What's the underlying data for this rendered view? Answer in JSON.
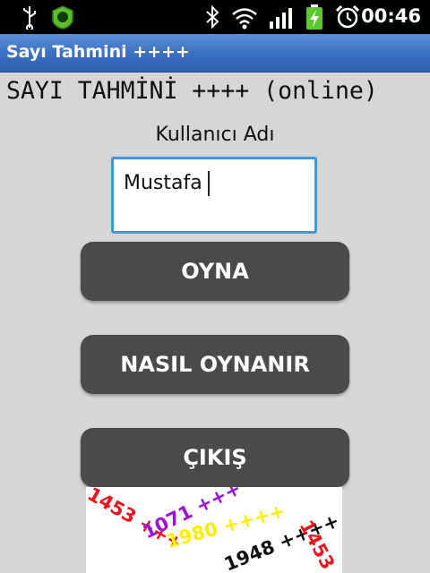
{
  "status_bar": {
    "time": "00:46",
    "icons": [
      "usb-icon",
      "app-notification-icon",
      "bluetooth-icon",
      "wifi-icon",
      "signal-icon",
      "battery-charging-icon",
      "alarm-icon"
    ]
  },
  "title_bar": {
    "title": "Sayı Tahmini ++++"
  },
  "main": {
    "headline": "SAYI TAHMİNİ ++++ (online)",
    "username_label": "Kullanıcı Adı",
    "username_value": "Mustafa",
    "buttons": {
      "play": "OYNA",
      "how_to_play": "NASIL OYNANIR",
      "exit": "ÇIKIŞ"
    }
  },
  "graffiti": {
    "texts": [
      "1453 +++",
      "1071 +++",
      "1980 ++++",
      "1948 ++++",
      "1453"
    ],
    "colors": {
      "red": "#e8141e",
      "purple": "#9b12d6",
      "yellow": "#ffee00",
      "black": "#111111"
    }
  }
}
